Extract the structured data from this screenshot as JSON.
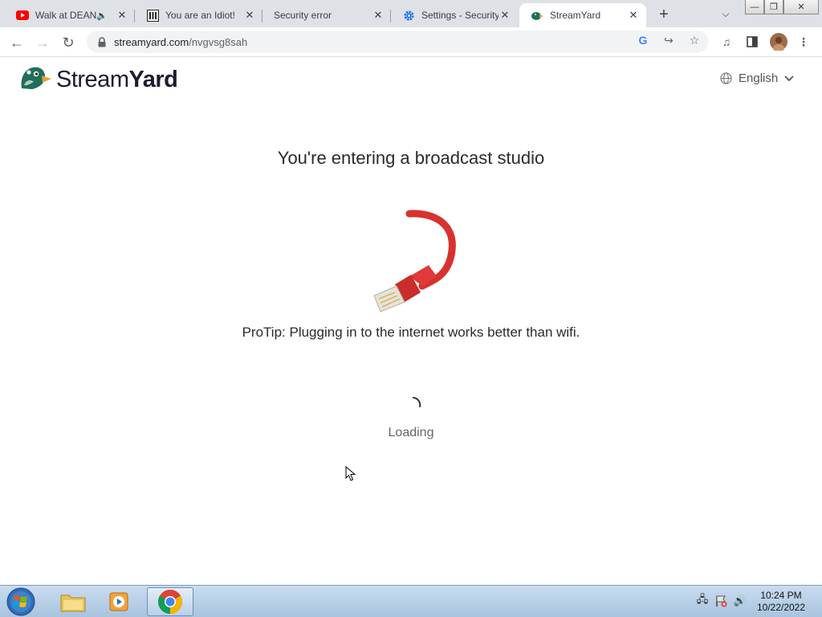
{
  "browser": {
    "tabs": [
      {
        "title": "Walk at DEAN",
        "favicon": "youtube-icon",
        "audio": true
      },
      {
        "title": "You are an Idiot!",
        "favicon": "site-icon"
      },
      {
        "title": "Security error",
        "favicon": "none"
      },
      {
        "title": "Settings - Security",
        "favicon": "gear-icon"
      },
      {
        "title": "StreamYard",
        "favicon": "streamyard-icon",
        "active": true
      }
    ],
    "url_domain": "streamyard.com",
    "url_path": "/nvgvsg8sah"
  },
  "page": {
    "logo_light": "Stream",
    "logo_bold": "Yard",
    "language": "English",
    "headline": "You're entering a broadcast studio",
    "protip": "ProTip: Plugging in to the internet works better than wifi.",
    "loading": "Loading"
  },
  "taskbar": {
    "apps": [
      "windows-explorer",
      "media-player",
      "chrome"
    ],
    "time": "10:24 PM",
    "date": "10/22/2022"
  },
  "colors": {
    "accent_red": "#e03a3a",
    "youtube_red": "#ff0000",
    "settings_blue": "#1a73e8",
    "duck_green": "#1f6f5b"
  }
}
